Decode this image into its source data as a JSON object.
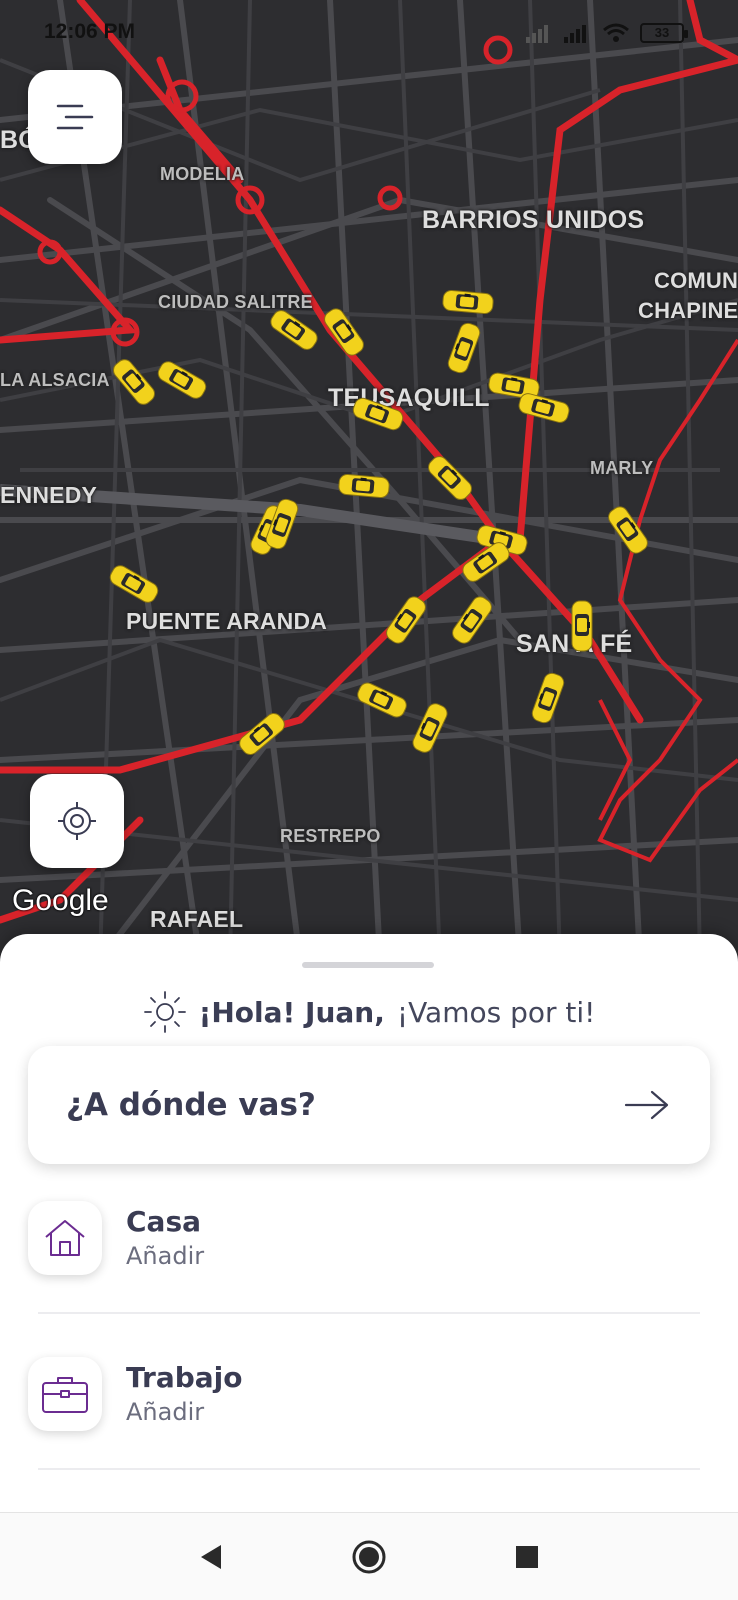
{
  "status_bar": {
    "time": "12:06 PM",
    "battery": "33",
    "icons": [
      "signal-icon",
      "signal-icon",
      "wifi-icon",
      "battery-icon"
    ]
  },
  "map": {
    "labels": {
      "bo": "BÓ",
      "modelia": "MODELIA",
      "barrios_unidos": "BARRIOS UNIDOS",
      "comun": "COMUN",
      "chapine": "CHAPINE",
      "ciudad_salitre": "CIUDAD SALITRE",
      "la_alsacia": "LA ALSACIA",
      "teusaquillo": "TEUSAQUILL",
      "marly": "MARLY",
      "kennedy": "ENNEDY",
      "puente_aranda": "PUENTE ARANDA",
      "santa_fe": "SAN  A FÉ",
      "restrepo": "RESTREPO",
      "rafael": "RAFAEL"
    },
    "attribution": "Google",
    "accent_red": "#d8232a",
    "taxi_yellow": "#f2d21c"
  },
  "buttons": {
    "menu_icon": "menu-icon",
    "locate_icon": "crosshair-icon"
  },
  "sheet": {
    "greeting_icon": "sun-icon",
    "greeting_name": "¡Hola! Juan,",
    "greeting_rest": "¡Vamos por ti!",
    "destination_prompt": "¿A dónde vas?",
    "destination_icon": "arrow-right-icon",
    "places": [
      {
        "title": "Casa",
        "subtitle": "Añadir",
        "icon": "home-icon"
      },
      {
        "title": "Trabajo",
        "subtitle": "Añadir",
        "icon": "briefcase-icon"
      }
    ],
    "accent_purple": "#6b2c91"
  },
  "nav_bar": {
    "back_icon": "back-triangle-icon",
    "home_icon": "home-circle-icon",
    "recents_icon": "recents-square-icon"
  }
}
